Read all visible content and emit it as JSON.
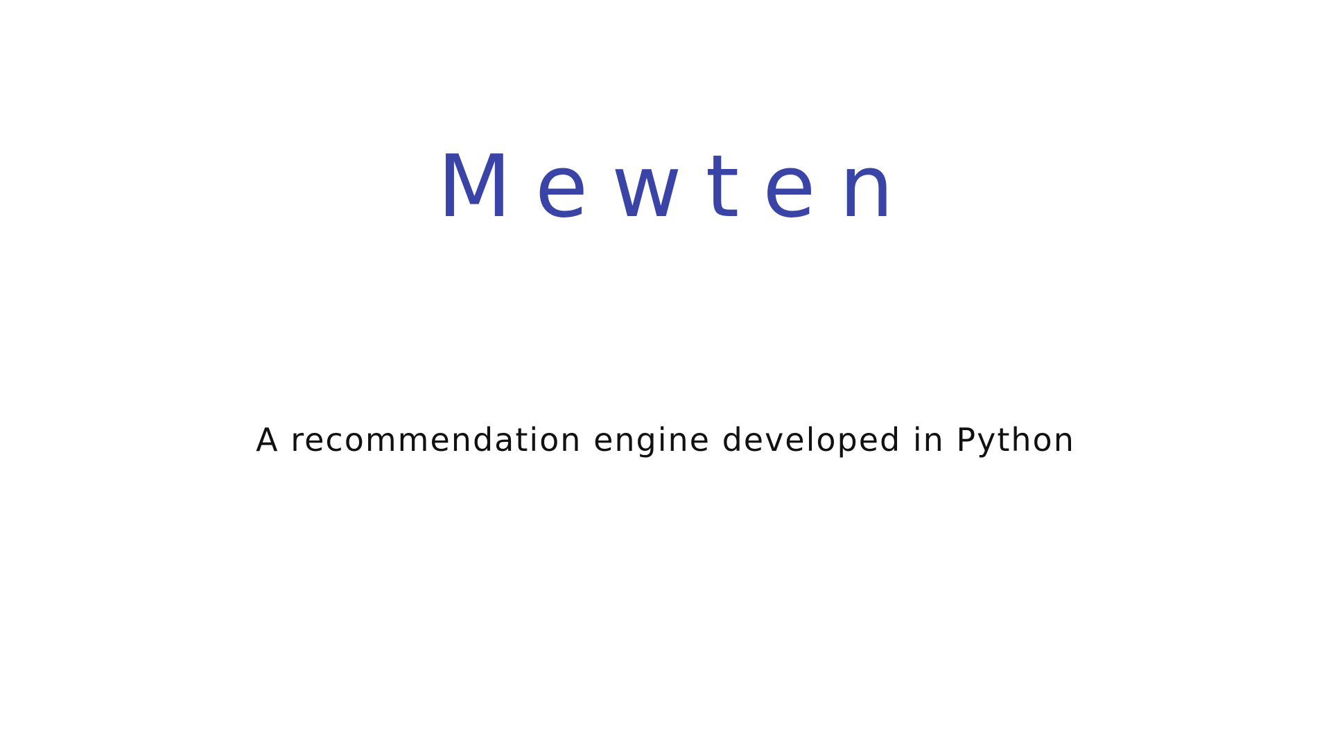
{
  "slide": {
    "title": "Mewten",
    "subtitle": "A recommendation engine developed in Python"
  },
  "colors": {
    "title": "#3a44a6",
    "subtitle": "#111111",
    "background": "#ffffff"
  }
}
